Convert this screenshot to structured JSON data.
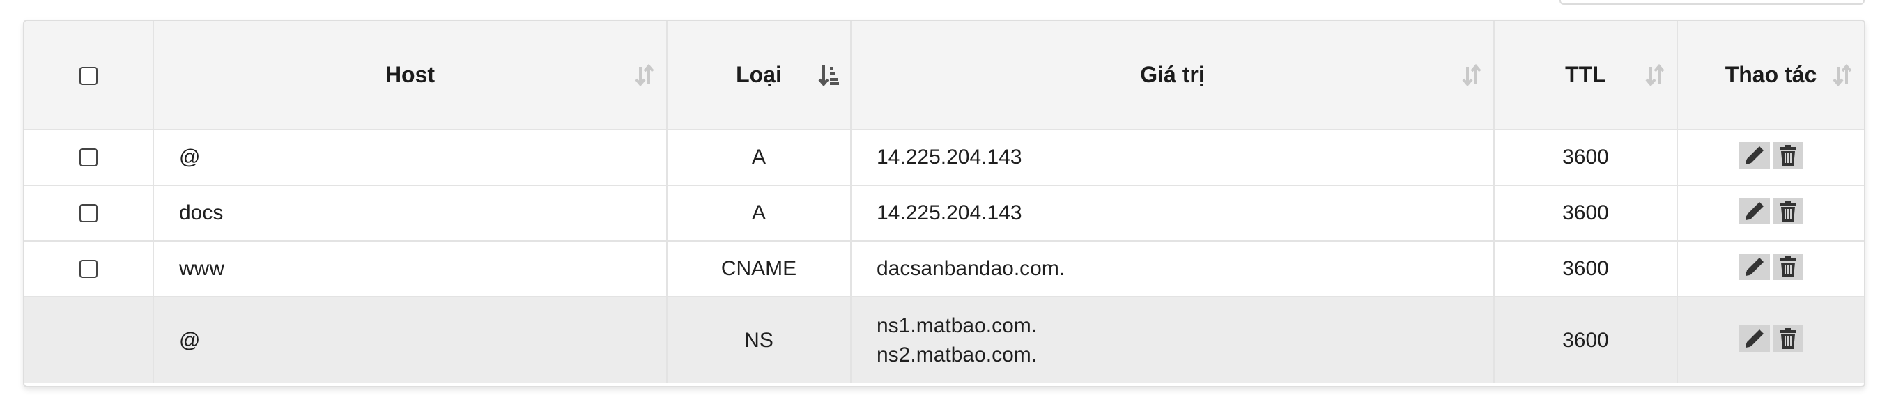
{
  "table": {
    "columns": [
      {
        "key": "host",
        "label": "Host",
        "sort_icon": "sort-arrows-icon"
      },
      {
        "key": "type",
        "label": "Loại",
        "sort_icon": "sort-active-icon"
      },
      {
        "key": "value",
        "label": "Giá trị",
        "sort_icon": "sort-arrows-icon"
      },
      {
        "key": "ttl",
        "label": "TTL",
        "sort_icon": "sort-arrows-icon"
      },
      {
        "key": "actions",
        "label": "Thao tác",
        "sort_icon": "sort-arrows-icon"
      }
    ],
    "rows": [
      {
        "host": "@",
        "type": "A",
        "value": [
          "14.225.204.143"
        ],
        "ttl": "3600",
        "selectable": true
      },
      {
        "host": "docs",
        "type": "A",
        "value": [
          "14.225.204.143"
        ],
        "ttl": "3600",
        "selectable": true
      },
      {
        "host": "www",
        "type": "CNAME",
        "value": [
          "dacsanbandao.com."
        ],
        "ttl": "3600",
        "selectable": true
      },
      {
        "host": "@",
        "type": "NS",
        "value": [
          "ns1.matbao.com.",
          "ns2.matbao.com."
        ],
        "ttl": "3600",
        "selectable": false
      }
    ],
    "row_actions": [
      "pencil-icon",
      "trash-icon"
    ]
  },
  "colors": {
    "header_bg": "#f4f4f4",
    "ns_row_bg": "#ececec",
    "border": "#e3e3e3",
    "action_bg": "#d3d3d3",
    "icon": "#333333"
  }
}
